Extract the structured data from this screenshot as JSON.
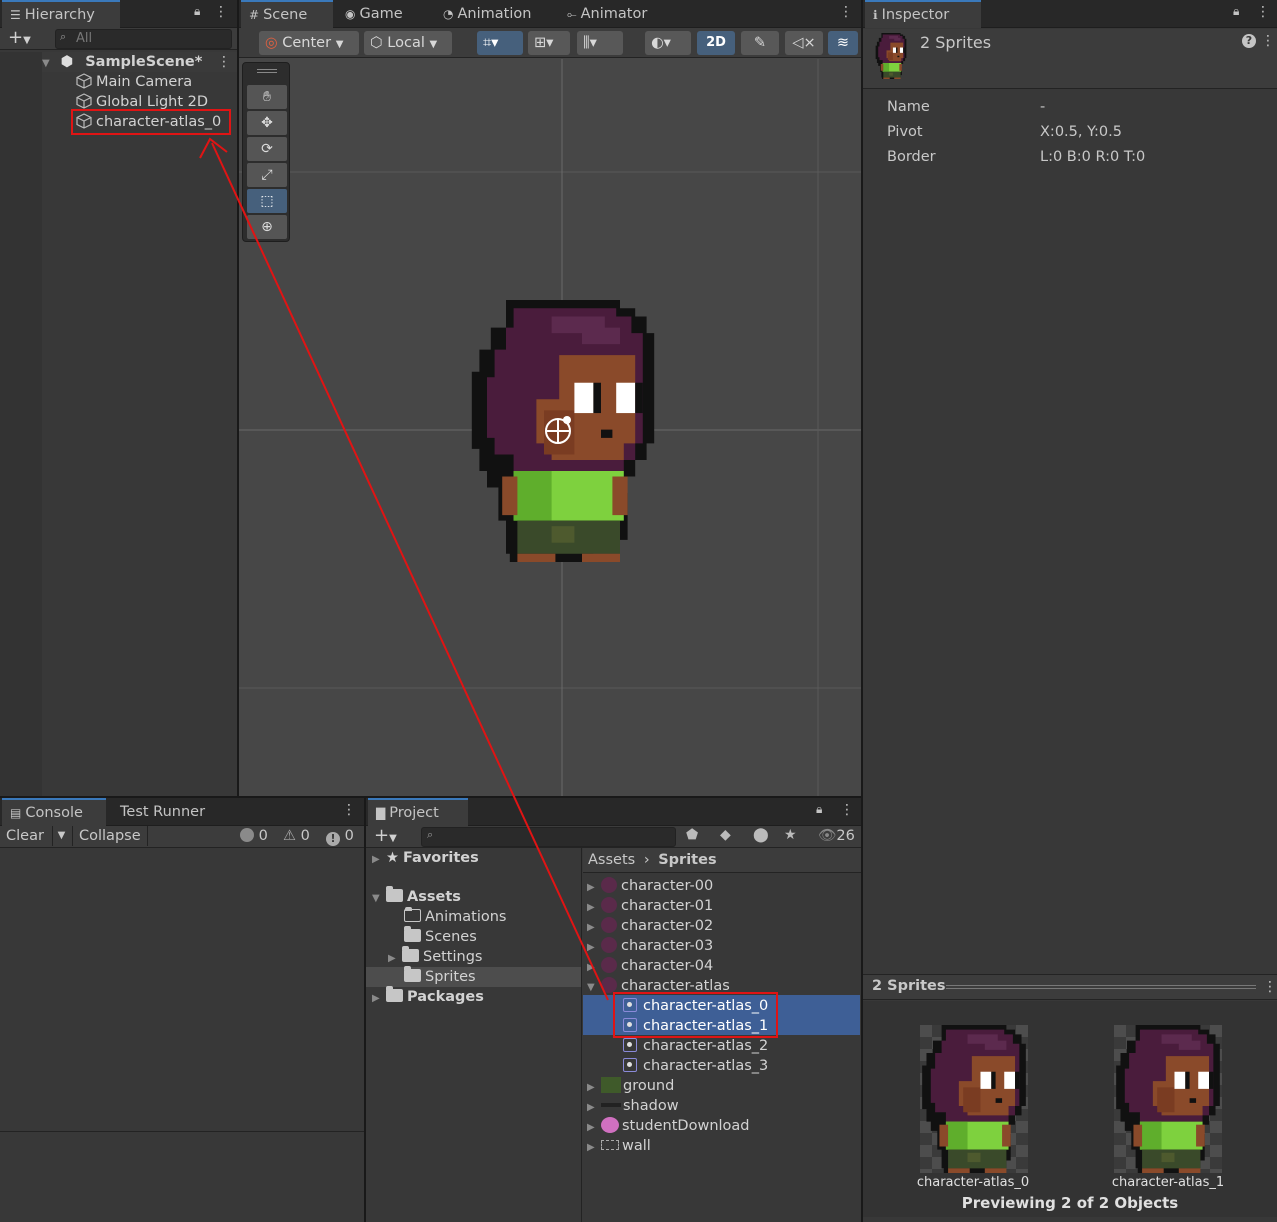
{
  "hierarchy": {
    "tab": "Hierarchy",
    "search_placeholder": "All",
    "scene": "SampleScene*",
    "items": [
      "Main Camera",
      "Global Light 2D",
      "character-atlas_0"
    ]
  },
  "scene_tabs": [
    "Scene",
    "Game",
    "Animation",
    "Animator"
  ],
  "scene_toolbar": {
    "pivot": "Center",
    "space": "Local",
    "mode_2d": "2D"
  },
  "inspector": {
    "tab": "Inspector",
    "title": "2 Sprites",
    "props": [
      {
        "label": "Name",
        "value": "-"
      },
      {
        "label": "Pivot",
        "value": "X:0.5, Y:0.5"
      },
      {
        "label": "Border",
        "value": "L:0 B:0 R:0 T:0"
      }
    ],
    "preview_title": "2 Sprites",
    "previews": [
      "character-atlas_0",
      "character-atlas_1"
    ],
    "preview_caption": "Previewing 2 of 2 Objects"
  },
  "console": {
    "tabs": [
      "Console",
      "Test Runner"
    ],
    "clear": "Clear",
    "collapse": "Collapse",
    "counts": [
      "0",
      "0",
      "0"
    ]
  },
  "project": {
    "tab": "Project",
    "hidden_count": "26",
    "favorites": "Favorites",
    "assets": "Assets",
    "folders": [
      "Animations",
      "Scenes",
      "Settings",
      "Sprites"
    ],
    "packages": "Packages",
    "breadcrumb": [
      "Assets",
      "Sprites"
    ],
    "files": [
      "character-00",
      "character-01",
      "character-02",
      "character-03",
      "character-04",
      "character-atlas"
    ],
    "sub_sprites": [
      "character-atlas_0",
      "character-atlas_1",
      "character-atlas_2",
      "character-atlas_3"
    ],
    "other_files": [
      "ground",
      "shadow",
      "studentDownload",
      "wall"
    ]
  },
  "colors": {
    "selection": "#3e5f96",
    "highlight_box": "#e01414",
    "active_tab_line": "#3a79bb"
  }
}
